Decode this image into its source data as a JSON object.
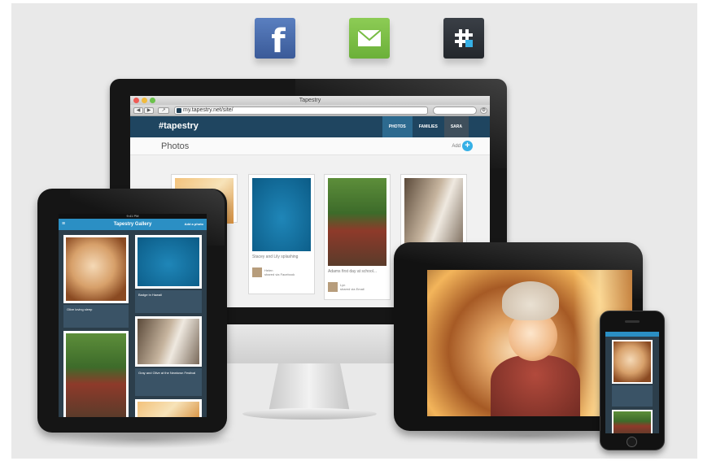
{
  "share_icons": [
    {
      "name": "facebook",
      "icon": "facebook-icon",
      "color": "#3b5998"
    },
    {
      "name": "email",
      "icon": "envelope-icon",
      "color": "#77bc43"
    },
    {
      "name": "tapestry",
      "icon": "tapestry-hash-icon",
      "color": "#2a2f35"
    }
  ],
  "browser": {
    "title": "Tapestry",
    "url": "my.tapestry.net/site/",
    "logo": "#tapestry",
    "nav": [
      "PHOTOS",
      "FAMILIES",
      "SARA"
    ],
    "page_title": "Photos",
    "add_label": "Add",
    "cards": [
      {
        "caption": "Stacey and Lily splashing",
        "author": "Helen",
        "shared_via": "shared via Facebook"
      },
      {
        "caption": "Adams first day at school...",
        "author": "Lyn",
        "shared_via": "shared via Email"
      }
    ]
  },
  "tablet_left": {
    "status": "9:41 PM",
    "header_title": "Tapestry Gallery",
    "header_action": "Add a photo",
    "captions": [
      "Olive loving sleep",
      "Badge in Hawaii",
      "Gray and Olive at the Newtown Festival"
    ]
  },
  "colors": {
    "app_header": "#1f4560",
    "accent_blue": "#36b0e6",
    "tablet_header": "#2b8fc4",
    "background": "#e9e9e9"
  }
}
